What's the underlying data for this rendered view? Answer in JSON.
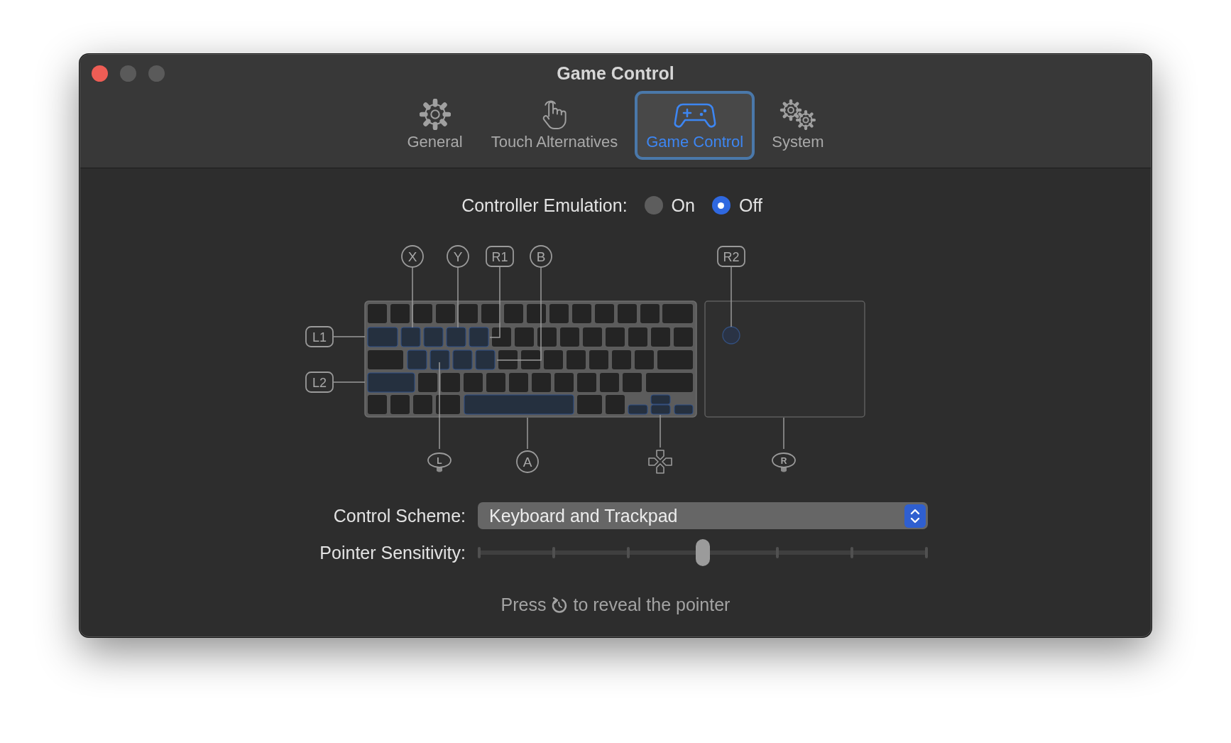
{
  "window": {
    "title": "Game Control"
  },
  "tabs": [
    {
      "kind": "gear",
      "label": "General",
      "selected": false
    },
    {
      "kind": "hand",
      "label": "Touch Alternatives",
      "selected": false
    },
    {
      "kind": "gamepad",
      "label": "Game Control",
      "selected": true
    },
    {
      "kind": "gears",
      "label": "System",
      "selected": false
    }
  ],
  "emulation": {
    "label": "Controller Emulation:",
    "options": [
      {
        "label": "On",
        "selected": false
      },
      {
        "label": "Off",
        "selected": true
      }
    ]
  },
  "diagram": {
    "callouts": [
      {
        "kind": "circle",
        "label": "X"
      },
      {
        "kind": "circle",
        "label": "Y"
      },
      {
        "kind": "tag",
        "label": "R1"
      },
      {
        "kind": "circle",
        "label": "B"
      },
      {
        "kind": "tag",
        "label": "R2"
      },
      {
        "kind": "tag",
        "label": "L1"
      },
      {
        "kind": "tag",
        "label": "L2"
      },
      {
        "kind": "stick",
        "label": "L"
      },
      {
        "kind": "circle",
        "label": "A"
      },
      {
        "kind": "dpad"
      },
      {
        "kind": "stick",
        "label": "R"
      }
    ]
  },
  "control_scheme": {
    "label": "Control Scheme:",
    "value": "Keyboard and Trackpad"
  },
  "pointer_sensitivity": {
    "label": "Pointer Sensitivity:",
    "level": 0.5
  },
  "hint": {
    "before": "Press",
    "after": "to reveal the pointer"
  }
}
